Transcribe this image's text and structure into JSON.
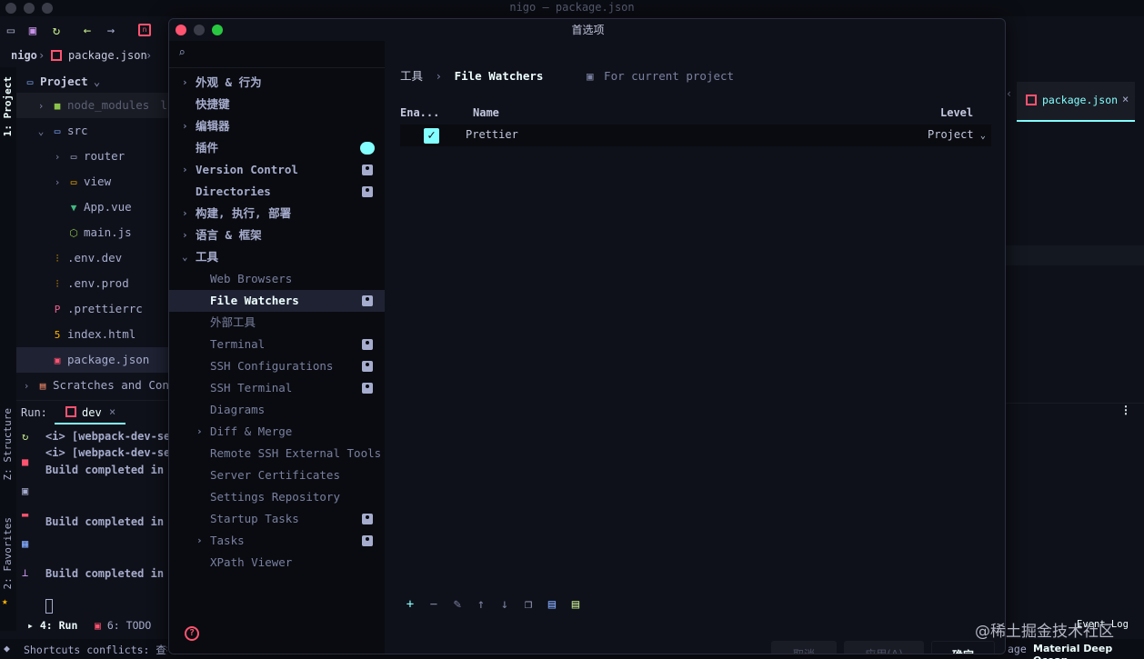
{
  "window": {
    "title": "nigo — package.json"
  },
  "breadcrumb": {
    "project": "nigo",
    "file": "package.json"
  },
  "side_tabs": {
    "project": "1: Project",
    "structure": "Z: Structure",
    "favorites": "2: Favorites"
  },
  "project_panel": {
    "header": "Project",
    "items": [
      {
        "label": "node_modules",
        "suffix": "l",
        "icon": "folder-icon",
        "color": "#9e9e9e"
      },
      {
        "label": "src",
        "icon": "folder-icon",
        "color": "#7e57c2"
      },
      {
        "label": "router",
        "icon": "folder-icon",
        "color": "#a6accd"
      },
      {
        "label": "view",
        "icon": "folder-icon",
        "color": "#a6accd"
      },
      {
        "label": "App.vue",
        "icon": "vue-icon",
        "color": "#41b883"
      },
      {
        "label": "main.js",
        "icon": "node-icon",
        "color": "#8bc34a"
      },
      {
        "label": ".env.dev",
        "icon": "env-icon",
        "color": "#ffb300"
      },
      {
        "label": ".env.prod",
        "icon": "env-icon",
        "color": "#ffb300"
      },
      {
        "label": ".prettierrc",
        "icon": "prettier-icon",
        "color": "#f06292"
      },
      {
        "label": "index.html",
        "icon": "html-icon",
        "color": "#ffb300"
      },
      {
        "label": "package.json",
        "icon": "npm-icon",
        "color": "#ff5370"
      },
      {
        "label": "Scratches and Cons",
        "icon": "scratch-icon",
        "color": "#a6accd"
      }
    ]
  },
  "run_panel": {
    "label": "Run:",
    "tab": "dev",
    "lines": [
      {
        "text": "<i> [webpack-dev-se",
        "color": "#c3e88d"
      },
      {
        "text": "<i> [webpack-dev-se",
        "color": "#c3e88d"
      },
      {
        "text": "Build completed in",
        "color": "#c3e88d"
      },
      {
        "text": "Build completed in",
        "color": "#c3e88d"
      },
      {
        "text": "Build completed in",
        "color": "#c3e88d"
      }
    ]
  },
  "bottom_tabs": {
    "run": "4: Run",
    "todo": "6: TODO"
  },
  "status_bar": {
    "message": "Shortcuts conflicts: 查找",
    "right_text": "age",
    "theme": "Material Deep Ocean"
  },
  "editor_tab": {
    "label": "package.json"
  },
  "event_log": "Event Log",
  "dialog": {
    "title": "首选项",
    "nav": [
      {
        "label": "外观 & 行为",
        "chevron": true,
        "indent": 0
      },
      {
        "label": "快捷键",
        "chevron": false,
        "indent": 0
      },
      {
        "label": "编辑器",
        "chevron": true,
        "indent": 0
      },
      {
        "label": "插件",
        "chevron": false,
        "indent": 0,
        "badge": "dot"
      },
      {
        "label": "Version Control",
        "chevron": true,
        "indent": 0,
        "badge": "project"
      },
      {
        "label": "Directories",
        "chevron": false,
        "indent": 0,
        "badge": "project"
      },
      {
        "label": "构建, 执行, 部署",
        "chevron": true,
        "indent": 0
      },
      {
        "label": "语言 & 框架",
        "chevron": true,
        "indent": 0
      },
      {
        "label": "工具",
        "chevron": "open",
        "indent": 0
      },
      {
        "label": "Web Browsers",
        "chevron": false,
        "indent": 1
      },
      {
        "label": "File Watchers",
        "chevron": false,
        "indent": 1,
        "badge": "project",
        "selected": true
      },
      {
        "label": "外部工具",
        "chevron": false,
        "indent": 1
      },
      {
        "label": "Terminal",
        "chevron": false,
        "indent": 1,
        "badge": "project"
      },
      {
        "label": "SSH Configurations",
        "chevron": false,
        "indent": 1,
        "badge": "project"
      },
      {
        "label": "SSH Terminal",
        "chevron": false,
        "indent": 1,
        "badge": "project"
      },
      {
        "label": "Diagrams",
        "chevron": false,
        "indent": 1
      },
      {
        "label": "Diff & Merge",
        "chevron": true,
        "indent": 1
      },
      {
        "label": "Remote SSH External Tools",
        "chevron": false,
        "indent": 1
      },
      {
        "label": "Server Certificates",
        "chevron": false,
        "indent": 1
      },
      {
        "label": "Settings Repository",
        "chevron": false,
        "indent": 1
      },
      {
        "label": "Startup Tasks",
        "chevron": false,
        "indent": 1,
        "badge": "project"
      },
      {
        "label": "Tasks",
        "chevron": true,
        "indent": 1,
        "badge": "project"
      },
      {
        "label": "XPath Viewer",
        "chevron": false,
        "indent": 1
      }
    ],
    "crumb": {
      "parent": "工具",
      "separator": "›",
      "current": "File Watchers",
      "scope": "For current project"
    },
    "table": {
      "columns": [
        "Ena...",
        "Name",
        "Level"
      ],
      "rows": [
        {
          "enabled": true,
          "name": "Prettier",
          "level": "Project"
        }
      ]
    },
    "toolbar_icons": [
      "add-icon",
      "remove-icon",
      "edit-icon",
      "move-up-icon",
      "move-down-icon",
      "copy-icon",
      "import-icon",
      "export-icon"
    ],
    "buttons": {
      "cancel": "取消",
      "apply": "应用(A)",
      "ok": "确定"
    }
  },
  "watermark": "@稀土掘金技术社区",
  "colors": {
    "accent": "#84ffff",
    "bg": "#0f111a",
    "nav_bg": "#090b10",
    "selection": "#1f2233",
    "error": "#ff5370"
  }
}
